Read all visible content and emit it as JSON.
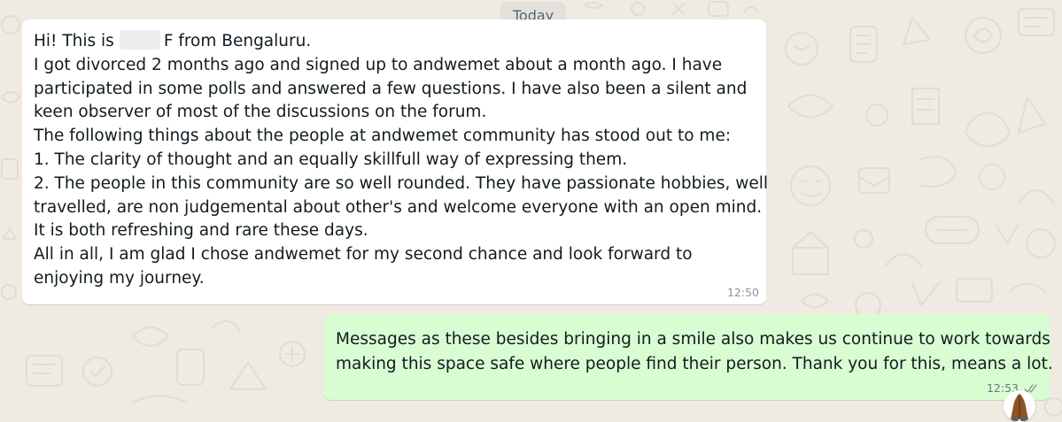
{
  "conversation": {
    "date_divider": "Today",
    "incoming": {
      "greeting_prefix": "Hi! This is",
      "greeting_suffix": "F from Bengaluru.",
      "lines": [
        "I got divorced 2 months ago and signed up to andwemet about a month ago. I have",
        "participated in some polls and answered a few questions. I have also been a silent and",
        "keen observer of most of the discussions on the forum.",
        "The following things about the people at andwemet community has stood out to me:",
        "1. The clarity of thought and an equally skillfull way of expressing them.",
        "2. The people in this community are so well rounded. They have passionate hobbies, well",
        "travelled, are non judgemental about other's and welcome everyone with an open mind.",
        "It is both refreshing and rare these days.",
        "All in all, I am glad I chose andwemet for my second chance and look forward to",
        "enjoying my journey."
      ],
      "time": "12:50"
    },
    "outgoing": {
      "lines": [
        "Messages as these besides bringing in a smile also makes us continue to work towards",
        "making this space safe where people find their person. Thank you for this, means a lot."
      ],
      "time": "12:53",
      "status_icon": "double-check-icon",
      "reaction_icon": "folded-hands-emoji"
    }
  },
  "colors": {
    "wallpaper": "#efeae2",
    "incoming_bubble": "#ffffff",
    "outgoing_bubble": "#d9fdd3",
    "text": "#111b21",
    "meta_text": "#8696a0"
  }
}
